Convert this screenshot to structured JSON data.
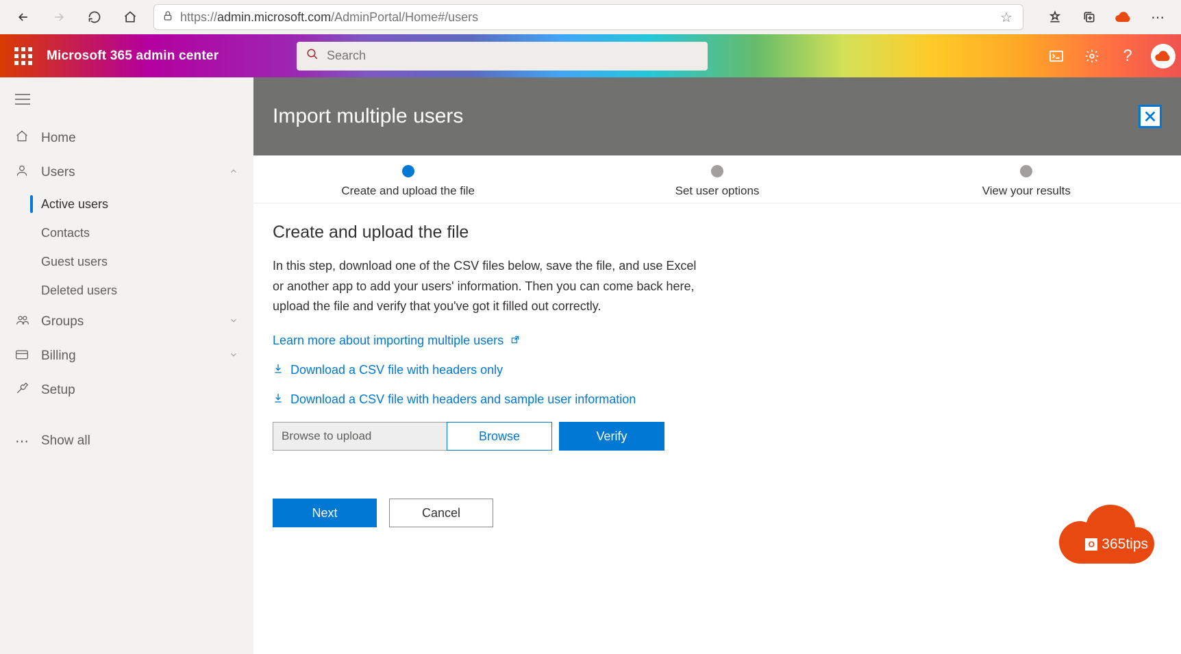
{
  "browser": {
    "url_prefix": "https://",
    "url_host": "admin.microsoft.com",
    "url_path": "/AdminPortal/Home#/users"
  },
  "suite": {
    "app_name": "Microsoft 365 admin center",
    "search_placeholder": "Search"
  },
  "sidebar": {
    "home": "Home",
    "users": "Users",
    "users_items": {
      "active": "Active users",
      "contacts": "Contacts",
      "guest": "Guest users",
      "deleted": "Deleted users"
    },
    "groups": "Groups",
    "billing": "Billing",
    "setup": "Setup",
    "show_all": "Show all"
  },
  "panel": {
    "title": "Import multiple users",
    "steps": {
      "s1": "Create and upload the file",
      "s2": "Set user options",
      "s3": "View your results"
    },
    "heading": "Create and upload the file",
    "description": "In this step, download one of the CSV files below, save the file, and use Excel or another app to add your users' information. Then you can come back here, upload the file and verify that you've got it filled out correctly.",
    "learn_more": "Learn more about importing multiple users",
    "dl_headers": "Download a CSV file with headers only",
    "dl_sample": "Download a CSV file with headers and sample user information",
    "upload_placeholder": "Browse to upload",
    "browse": "Browse",
    "verify": "Verify",
    "next": "Next",
    "cancel": "Cancel"
  },
  "brand": {
    "label": "365tips"
  }
}
